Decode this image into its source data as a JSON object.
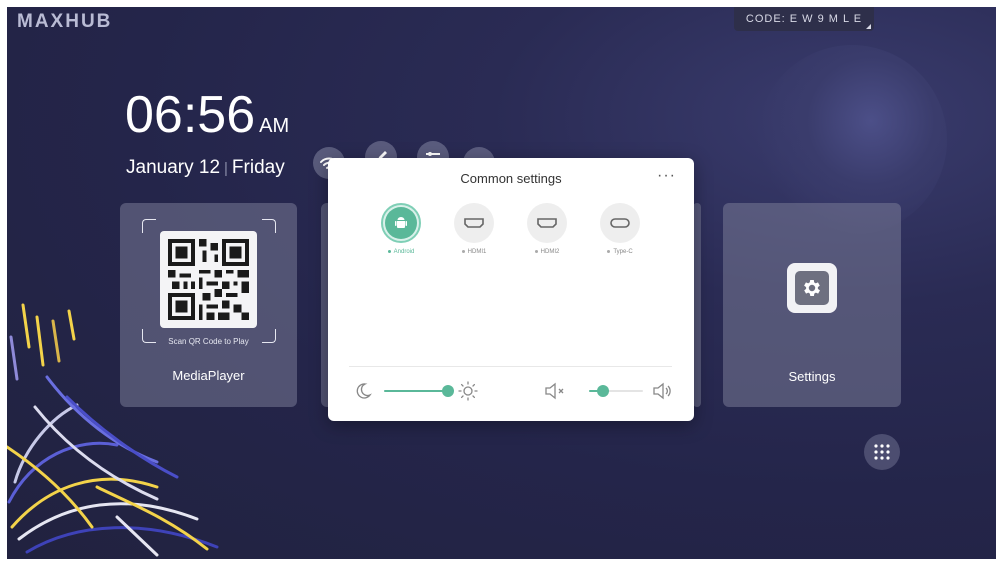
{
  "brand": "MAXHUB",
  "code_badge": "CODE: E W 9 M L E",
  "clock": {
    "time": "06:56",
    "ampm": "AM",
    "date": "January 12",
    "day": "Friday"
  },
  "tiles": {
    "media": {
      "label": "MediaPlayer",
      "qr_caption": "Scan QR Code to Play"
    },
    "settings": {
      "label": "Settings"
    }
  },
  "panel": {
    "title": "Common settings",
    "more": "···",
    "sources": [
      {
        "label": "Android",
        "icon": "android-icon",
        "active": true
      },
      {
        "label": "HDMI1",
        "icon": "hdmi-icon",
        "active": false
      },
      {
        "label": "HDMI2",
        "icon": "hdmi-icon",
        "active": false
      },
      {
        "label": "Type-C",
        "icon": "usb-c-icon",
        "active": false
      }
    ],
    "brightness": {
      "level": 1.0
    },
    "volume": {
      "level": 0.25
    }
  },
  "colors": {
    "accent": "#5ab899",
    "background": "#24254a"
  }
}
